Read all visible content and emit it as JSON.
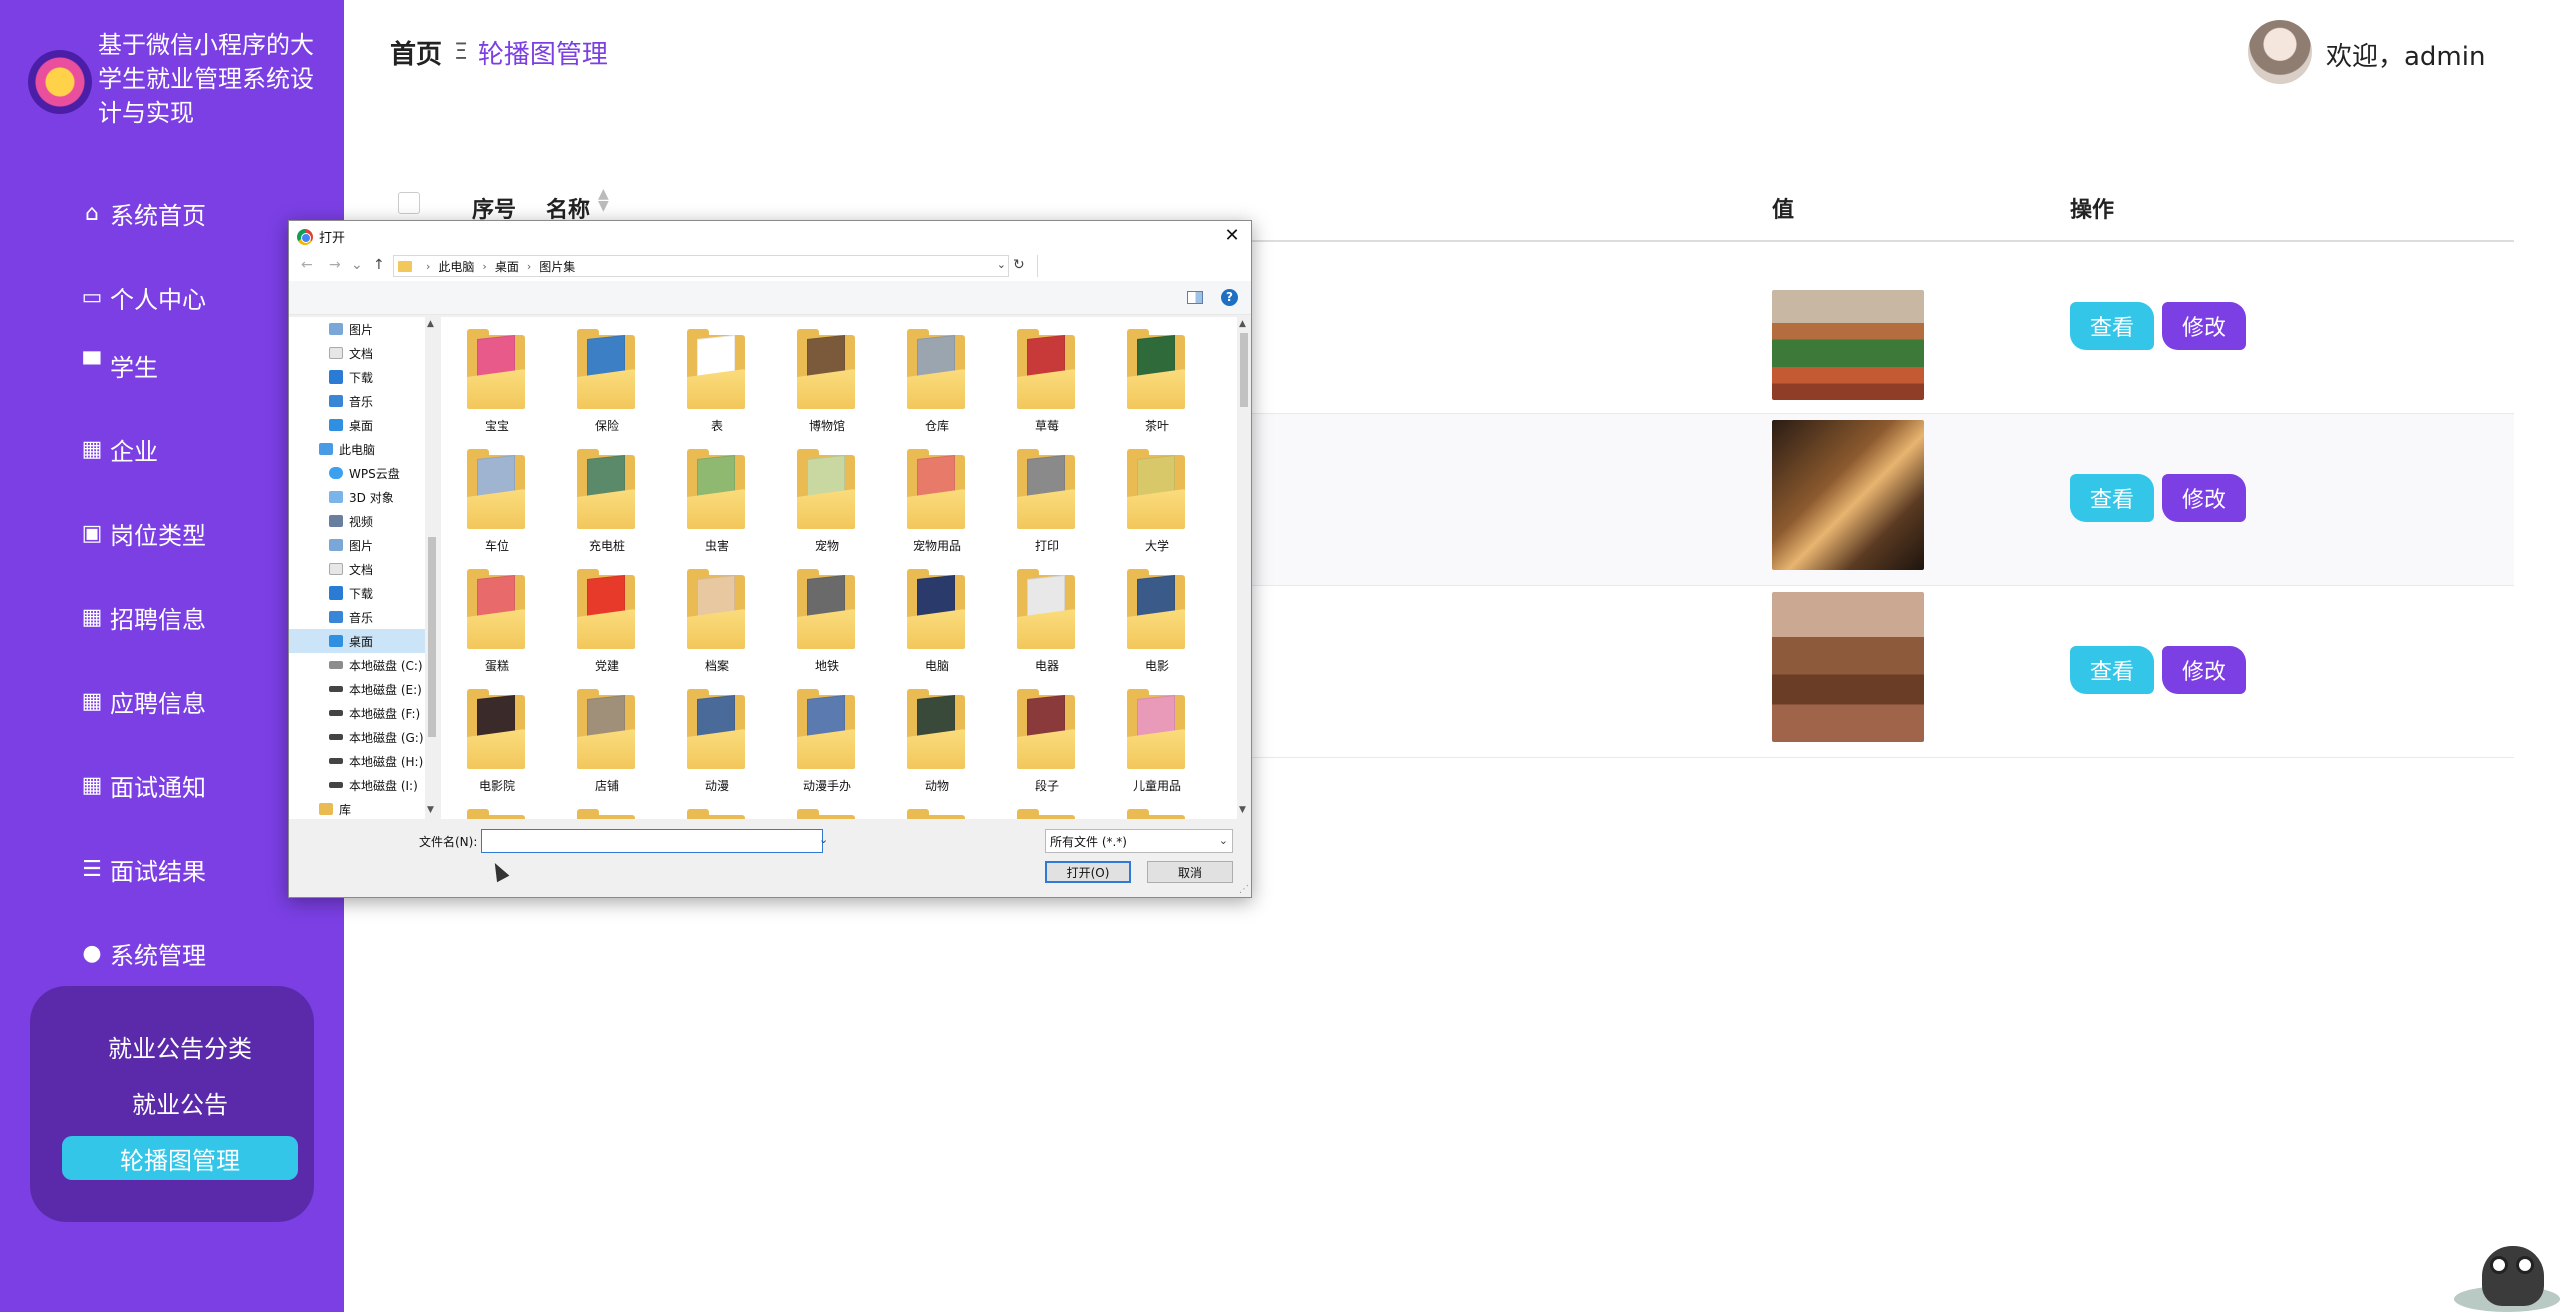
{
  "app": {
    "title": "基于微信小程序的大学生就业管理系统设计与实现"
  },
  "sidebar": {
    "items": [
      {
        "label": "系统首页",
        "icon": "home-icon"
      },
      {
        "label": "个人中心",
        "icon": "id-card-icon"
      },
      {
        "label": "学生",
        "icon": "monitor-icon"
      },
      {
        "label": "企业",
        "icon": "grid-icon"
      },
      {
        "label": "岗位类型",
        "icon": "clipboard-icon"
      },
      {
        "label": "招聘信息",
        "icon": "grid-icon"
      },
      {
        "label": "应聘信息",
        "icon": "grid-icon"
      },
      {
        "label": "面试通知",
        "icon": "grid-icon"
      },
      {
        "label": "面试结果",
        "icon": "list-icon"
      },
      {
        "label": "系统管理",
        "icon": "user-icon"
      }
    ],
    "submenu": [
      "就业公告分类",
      "就业公告",
      "轮播图管理"
    ]
  },
  "header": {
    "breadcrumb_home": "首页",
    "breadcrumb_sep": "Ξ",
    "breadcrumb_current": "轮播图管理",
    "welcome": "欢迎，admin"
  },
  "table": {
    "headers": {
      "index": "序号",
      "name": "名称",
      "value": "值",
      "actions": "操作"
    },
    "view_label": "查看",
    "edit_label": "修改",
    "row_count": 3
  },
  "dialog": {
    "title": "打开",
    "path": [
      "此电脑",
      "桌面",
      "图片集"
    ],
    "tree": [
      "图片",
      "文档",
      "下载",
      "音乐",
      "桌面",
      "此电脑",
      "WPS云盘",
      "3D 对象",
      "视频",
      "图片",
      "文档",
      "下载",
      "音乐",
      "桌面",
      "本地磁盘 (C:)",
      "本地磁盘 (E:)",
      "本地磁盘 (F:)",
      "本地磁盘 (G:)",
      "本地磁盘 (H:)",
      "本地磁盘 (I:)",
      "库"
    ],
    "files": [
      "宝宝",
      "保险",
      "表",
      "博物馆",
      "仓库",
      "草莓",
      "茶叶",
      "车位",
      "充电桩",
      "虫害",
      "宠物",
      "宠物用品",
      "打印",
      "大学",
      "蛋糕",
      "党建",
      "档案",
      "地铁",
      "电脑",
      "电器",
      "电影",
      "电影院",
      "店铺",
      "动漫",
      "动漫手办",
      "动物",
      "段子",
      "儿童用品"
    ],
    "filename_label": "文件名(N):",
    "filename_value": "",
    "filetype": "所有文件 (*.*)",
    "open_label": "打开(O)",
    "cancel_label": "取消"
  },
  "colors": {
    "primary": "#7b3fe4",
    "accent": "#34c6e8",
    "submenu_bg": "#5b2aab"
  }
}
